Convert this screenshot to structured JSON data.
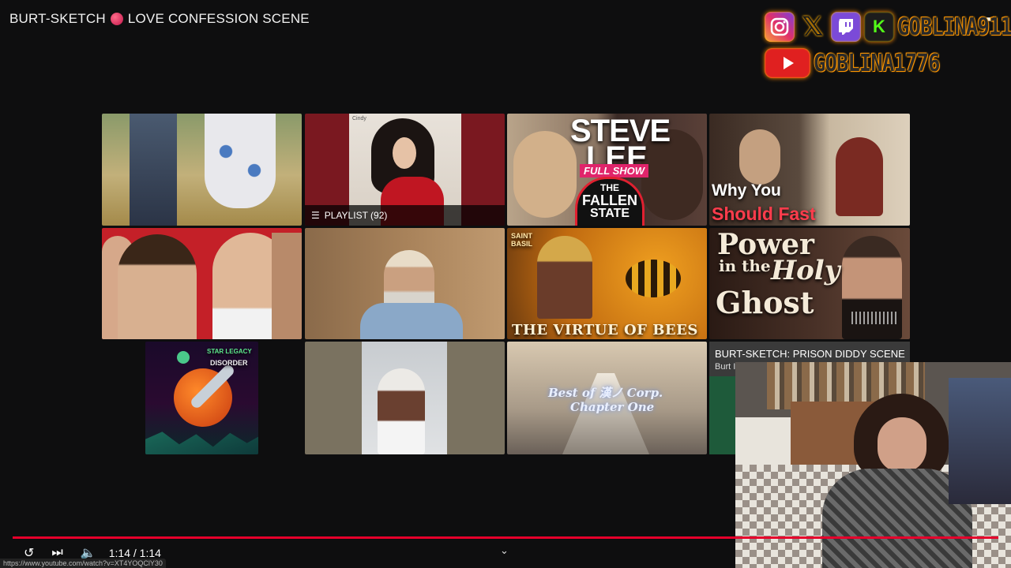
{
  "video": {
    "title": "BURT-SKETCH",
    "title_rest": "LOVE CONFESSION SCENE"
  },
  "social": {
    "handle1": "GOBLINA911",
    "handle2": "GOBLINA1776",
    "icons": [
      "instagram-icon",
      "x-icon",
      "twitch-icon",
      "kick-icon",
      "youtube-icon"
    ]
  },
  "tiles": {
    "t2": {
      "playlist_label": "PLAYLIST (92)",
      "cover_text_left": "Cindy"
    },
    "t3": {
      "line1": "STEVE",
      "line2": "LEE",
      "badge": "FULL SHOW",
      "ring1": "THE",
      "ring2": "FALLEN",
      "ring3": "STATE"
    },
    "t4": {
      "line1": "Why You",
      "line2": "Should Fast"
    },
    "t7": {
      "side": "SAINT BASIL",
      "caption": "THE VIRTUE OF BEES"
    },
    "t8": {
      "line1": "Power",
      "line2": "in the",
      "line3": "Holy",
      "line4": "Ghost"
    },
    "t9": {
      "line1": "STAR LEGACY",
      "line2": "DISORDER"
    },
    "t11": {
      "line1": "Best of 漢ノ Corp.",
      "line2": "Chapter One"
    }
  },
  "end_card": {
    "title": "BURT-SKETCH: PRISON DIDDY SCENE",
    "channel": "Burt I"
  },
  "player": {
    "time": "1:14 / 1:14",
    "progress": 1.0,
    "url": "https://www.youtube.com/watch?v=XT4YOQClY30"
  },
  "colors": {
    "progress": "#e5002b",
    "accent_orange": "#ff8a00"
  }
}
